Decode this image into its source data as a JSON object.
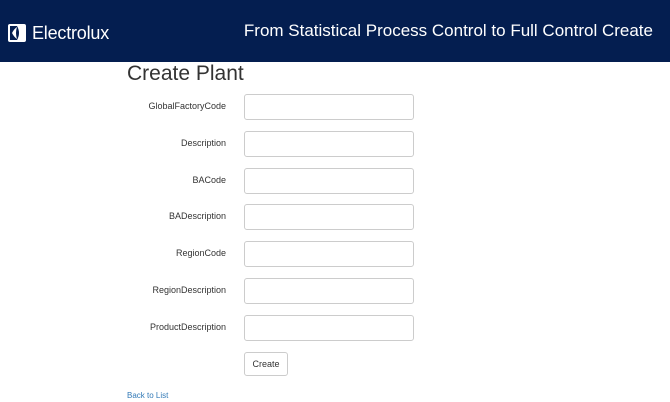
{
  "header": {
    "brand": "Electrolux",
    "title": "From Statistical Process Control to Full Control Create"
  },
  "page": {
    "title": "Create Plant"
  },
  "form": {
    "fields": [
      {
        "label": "GlobalFactoryCode",
        "value": ""
      },
      {
        "label": "Description",
        "value": ""
      },
      {
        "label": "BACode",
        "value": ""
      },
      {
        "label": "BADescription",
        "value": ""
      },
      {
        "label": "RegionCode",
        "value": ""
      },
      {
        "label": "RegionDescription",
        "value": ""
      },
      {
        "label": "ProductDescription",
        "value": ""
      }
    ],
    "submit_label": "Create"
  },
  "footer": {
    "back_link": "Back to List"
  },
  "colors": {
    "navbar": "#041e50",
    "link": "#337ab7"
  }
}
